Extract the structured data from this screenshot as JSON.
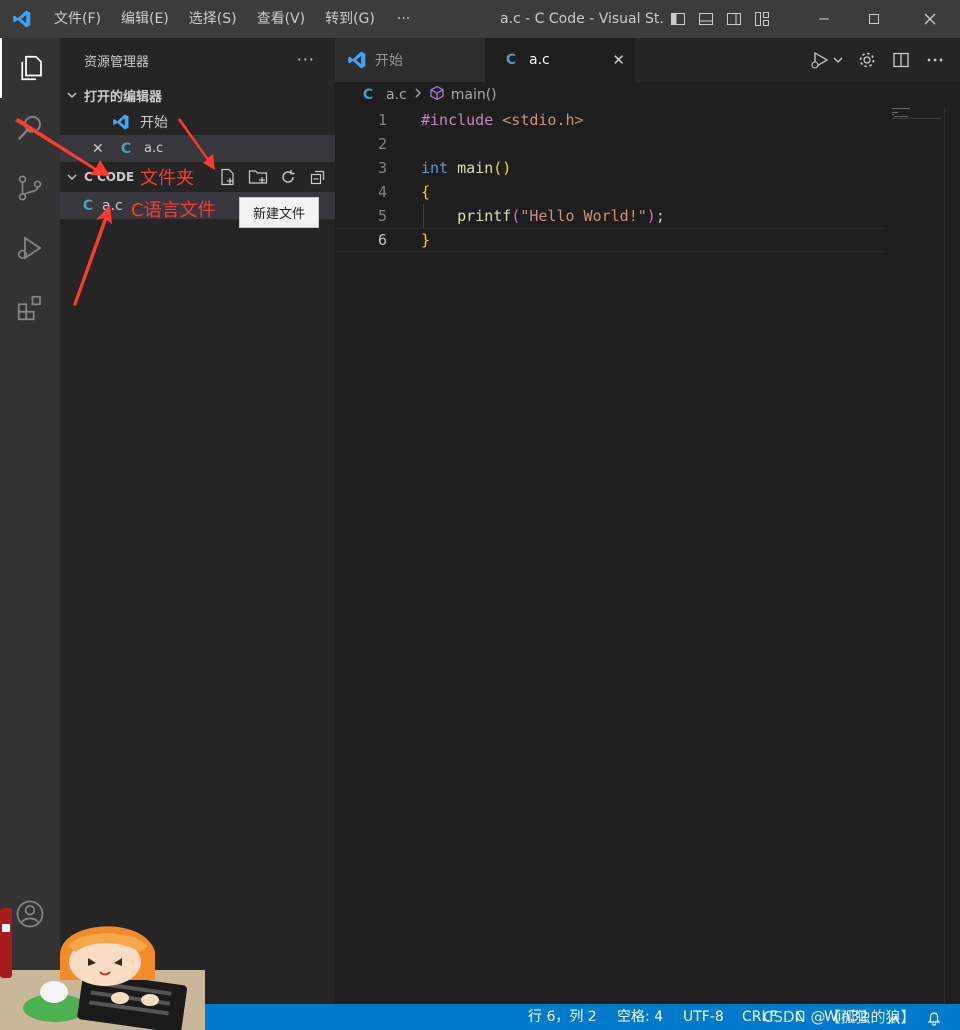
{
  "titlebar": {
    "menu": [
      "文件(F)",
      "编辑(E)",
      "选择(S)",
      "查看(V)",
      "转到(G)"
    ],
    "more": "···",
    "title": "a.c - C Code - Visual St..."
  },
  "sidebar": {
    "header": "资源管理器",
    "more": "···",
    "open_editors_label": "打开的编辑器",
    "open_editors": [
      {
        "label": "开始",
        "icon": "vscode-icon"
      },
      {
        "label": "a.c",
        "icon": "c-file-icon",
        "close": "✕"
      }
    ],
    "folder_label": "C CODE",
    "files": [
      {
        "label": "a.c",
        "glyph": "C"
      }
    ],
    "tooltip": "新建文件"
  },
  "annotations": {
    "folder": "文件夹",
    "c_file": "C语言文件"
  },
  "tabs": [
    {
      "label": "开始"
    },
    {
      "label": "a.c",
      "glyph": "C",
      "close": "✕"
    }
  ],
  "breadcrumb": {
    "file": "a.c",
    "glyph": "C",
    "symbol": "main()"
  },
  "editor": {
    "line_numbers": [
      "1",
      "2",
      "3",
      "4",
      "5",
      "6"
    ],
    "current_line": "6"
  },
  "statusbar": {
    "position": "行 6，列 2",
    "spaces": "空格: 4",
    "encoding": "UTF-8",
    "eol": "CRLF",
    "language": "C",
    "platform": "Win32",
    "watermark": "CSDN @【孤独的狼】"
  },
  "colors": {
    "accent": "#007acc",
    "keyword": "#569cd6",
    "preprocessor": "#c586c0",
    "string": "#ce9178",
    "function": "#dcdcaa",
    "bracket": "#ffd700",
    "annotation": "#ff3b30"
  }
}
